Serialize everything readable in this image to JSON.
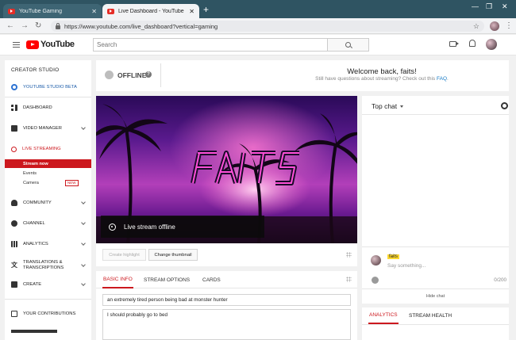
{
  "browser": {
    "tabs": [
      {
        "title": "YouTube Gaming"
      },
      {
        "title": "Live Dashboard - YouTube"
      }
    ],
    "url": "https://www.youtube.com/live_dashboard?vertical=gaming"
  },
  "header": {
    "logo_text": "YouTube",
    "search_placeholder": "Search"
  },
  "sidebar": {
    "title": "CREATOR STUDIO",
    "studio_beta": "YOUTUBE STUDIO BETA",
    "dashboard": "DASHBOARD",
    "video_manager": "VIDEO MANAGER",
    "live_streaming": "LIVE STREAMING",
    "stream_now": "Stream now",
    "events": "Events",
    "camera": "Camera",
    "new_badge": "NEW",
    "community": "COMMUNITY",
    "channel": "CHANNEL",
    "analytics": "ANALYTICS",
    "translations_1": "TRANSLATIONS &",
    "translations_2": "TRANSCRIPTIONS",
    "create": "CREATE",
    "contributions": "YOUR CONTRIBUTIONS"
  },
  "status": {
    "state": "OFFLINE",
    "help": "?",
    "welcome": "Welcome back, faits!",
    "sub_prefix": "Still have questions about streaming? Check out this ",
    "faq": "FAQ",
    "sub_suffix": "."
  },
  "preview": {
    "overlay": "Live stream offline",
    "logo_lettering": "FAITS",
    "create_highlight": "Create highlight",
    "change_thumbnail": "Change thumbnail"
  },
  "info": {
    "tabs": [
      "BASIC INFO",
      "STREAM OPTIONS",
      "CARDS"
    ],
    "title_value": "an extremely tired person being bad at monster hunter",
    "description_value": "I should probably go to bed"
  },
  "chat": {
    "header": "Top chat",
    "username": "faits",
    "placeholder": "Say something...",
    "counter": "0/200",
    "hide": "Hide chat"
  },
  "analytics": {
    "tabs": [
      "ANALYTICS",
      "STREAM HEALTH"
    ]
  },
  "colors": {
    "accent_red": "#cc181e",
    "link_blue": "#167ac6",
    "tabstrip": "#2f5462"
  }
}
